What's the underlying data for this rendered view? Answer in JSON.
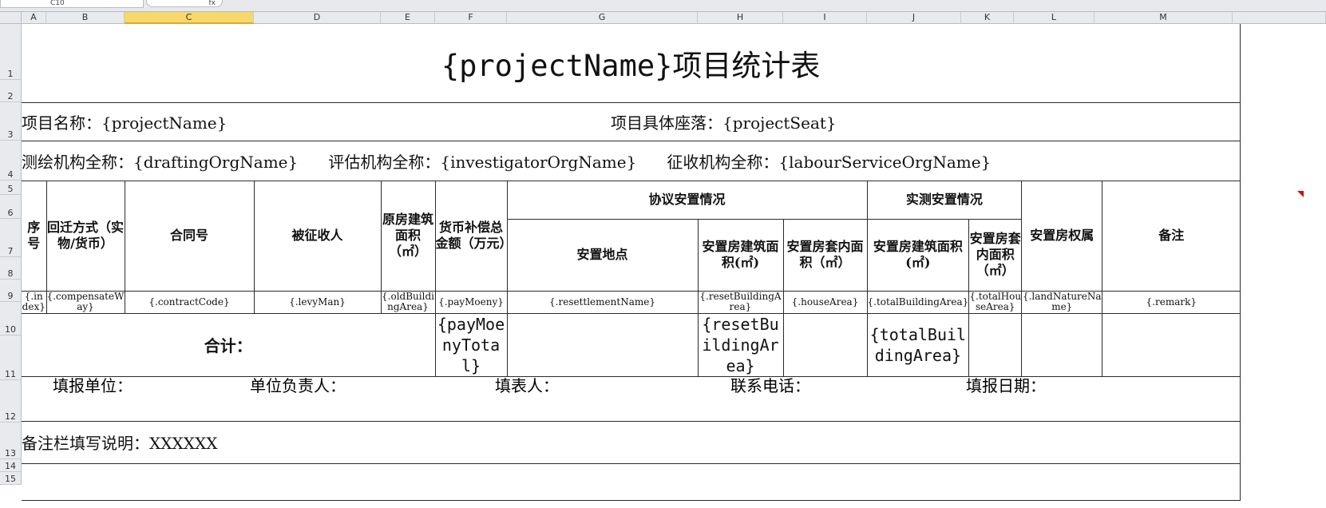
{
  "window": {
    "name_box": "C10",
    "fx_label": "fx"
  },
  "columns": [
    "A",
    "B",
    "C",
    "D",
    "E",
    "F",
    "G",
    "H",
    "I",
    "J",
    "K",
    "L",
    "M"
  ],
  "selected_column": "C",
  "rows": [
    "1",
    "2",
    "3",
    "4",
    "5",
    "6",
    "7",
    "8",
    "9",
    "10",
    "11",
    "12",
    "13",
    "14",
    "15"
  ],
  "sheet": {
    "title": "{projectName}项目统计表",
    "project_name": "项目名称：{projectName}",
    "project_seat": "项目具体座落：{projectSeat}",
    "org_line": "测绘机构全称：{draftingOrgName}      评估机构全称：{investigatorOrgName}      征收机构全称：{labourServiceOrgName}",
    "headers": {
      "seq": "序号",
      "method": "回迁方式（实物/货币）",
      "contract": "合同号",
      "levied": "被征收人",
      "orig_area": "原房建筑面积（㎡）",
      "payment": "货币补偿总金额（万元）",
      "agreement_group": "协议安置情况",
      "location": "安置地点",
      "reset_area": "安置房建筑面积(㎡)",
      "inner_area": "安置房套内面积（㎡）",
      "measured_group": "实测安置情况",
      "measured_area": "安置房建筑面积(㎡)",
      "measured_inner": "安置房套内面积（㎡）",
      "ownership": "安置房权属",
      "remark": "备注"
    },
    "data_row": {
      "index": "{.index}",
      "method": "{.compensateWay}",
      "contract": "{.contractCode}",
      "levied": "{.levyMan}",
      "orig_area": "{.oldBuildingArea}",
      "payment": "{.payMoeny}",
      "location": "{.resettlementName}",
      "reset_area": "{.resetBuildingArea}",
      "inner_area": "{.houseArea}",
      "measured_area": "{.totalBuildingArea}",
      "measured_inner": "{.totalHouseArea}",
      "ownership": "{.landNatureName}",
      "remark": "{.remark}"
    },
    "total_row": {
      "label": "合计：",
      "payment_total": "{payMoenyTotal}",
      "reset_total": "{resetBuildingArea}",
      "measured_total": "{totalBuildingArea}"
    },
    "footer": {
      "unit": "填报单位：",
      "leader": "单位负责人：",
      "filler": "填表人：",
      "phone": "联系电话：",
      "date": "填报日期："
    },
    "note": "备注栏填写说明：XXXXXX"
  },
  "colors": {
    "selected_header": "#f6d86c",
    "comment_marker": "#cc1010"
  }
}
